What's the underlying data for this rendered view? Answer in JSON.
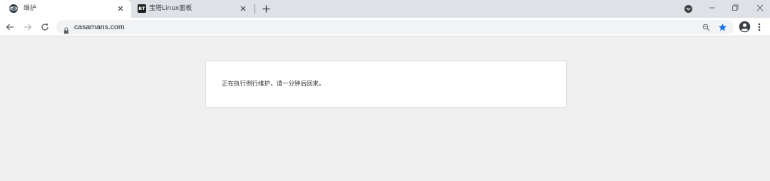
{
  "browser": {
    "tabs": [
      {
        "title": "维护",
        "active": true,
        "favicon": "globe-icon"
      },
      {
        "title": "宝塔Linux面板",
        "active": false,
        "favicon": "bt-panel-icon",
        "favicon_text": "BT"
      }
    ],
    "address_bar": {
      "url": "casamans.com",
      "secure_icon": "lock-icon"
    },
    "bookmark_color": "#1a73e8"
  },
  "page": {
    "message": "正在执行例行维护，请一分钟后回来。",
    "background_color": "#f0f0f0"
  }
}
